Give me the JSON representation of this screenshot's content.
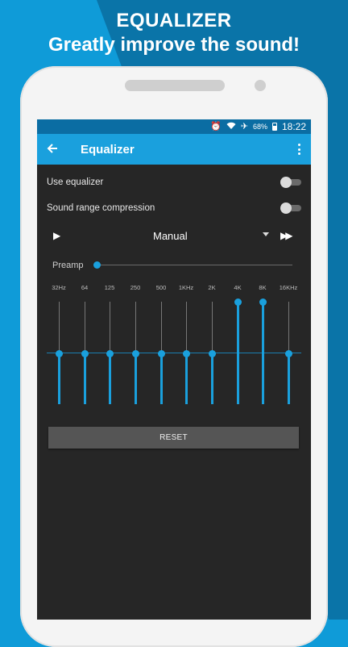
{
  "promo": {
    "title": "EQUALIZER",
    "subtitle": "Greatly improve the sound!"
  },
  "status": {
    "battery": "68%",
    "time": "18:22",
    "icons": [
      "alarm-icon",
      "wifi-icon",
      "airplane-icon",
      "battery-icon"
    ]
  },
  "toolbar": {
    "title": "Equalizer",
    "back_icon": "arrow-back-icon",
    "menu_icon": "overflow-menu-icon"
  },
  "settings": {
    "use_equalizer": {
      "label": "Use equalizer",
      "enabled": false
    },
    "sound_range_compression": {
      "label": "Sound range compression",
      "enabled": false
    }
  },
  "preset": {
    "name": "Manual"
  },
  "preamp": {
    "label": "Preamp",
    "level": 0.0
  },
  "bands": [
    {
      "label": "32Hz",
      "level": 0.5
    },
    {
      "label": "64",
      "level": 0.5
    },
    {
      "label": "125",
      "level": 0.5
    },
    {
      "label": "250",
      "level": 0.5
    },
    {
      "label": "500",
      "level": 0.5
    },
    {
      "label": "1KHz",
      "level": 0.5
    },
    {
      "label": "2K",
      "level": 0.5
    },
    {
      "label": "4K",
      "level": 1.0
    },
    {
      "label": "8K",
      "level": 1.0
    },
    {
      "label": "16KHz",
      "level": 0.5
    }
  ],
  "reset_label": "RESET",
  "colors": {
    "accent": "#1aa0dd",
    "statusbar": "#0b6da3",
    "screen_bg": "#262626"
  }
}
